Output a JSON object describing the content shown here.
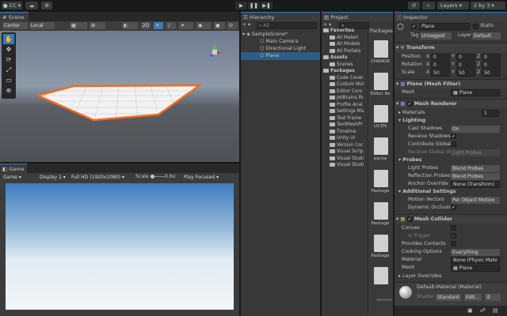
{
  "toolbar": {
    "account": "CC",
    "layers": "Layers",
    "layout": "2 by 3"
  },
  "scene": {
    "tab": "Scene",
    "pivot": "Center",
    "space": "Local",
    "mode2d": "2D",
    "tools": [
      "✋",
      "✥",
      "⟳",
      "⤢",
      "▭",
      "⊕"
    ]
  },
  "game": {
    "tab": "Game",
    "mode": "Game",
    "display": "Display 1",
    "resolution": "Full HD (1920x1080)",
    "scale_label": "Scale",
    "scale_value": "0.6x",
    "play_focused": "Play Focused"
  },
  "hierarchy": {
    "tab": "Hierarchy",
    "search_placeholder": "All",
    "items": [
      "SampleScene*",
      "Main Camera",
      "Directional Light",
      "Plane"
    ]
  },
  "project": {
    "tab": "Project",
    "tree": [
      {
        "label": "Favorites",
        "level": 0
      },
      {
        "label": "All Materi",
        "level": 1
      },
      {
        "label": "All Models",
        "level": 1
      },
      {
        "label": "All Prefabs",
        "level": 1
      },
      {
        "label": "Assets",
        "level": 0
      },
      {
        "label": "Scenes",
        "level": 1
      },
      {
        "label": "Packages",
        "level": 0
      },
      {
        "label": "Code Cover",
        "level": 1
      },
      {
        "label": "Custom NUr",
        "level": 1
      },
      {
        "label": "Editor Coro",
        "level": 1
      },
      {
        "label": "JetBrains Ri",
        "level": 1
      },
      {
        "label": "Profile Anal",
        "level": 1
      },
      {
        "label": "Settings Ma",
        "level": 1
      },
      {
        "label": "Test Frame",
        "level": 1
      },
      {
        "label": "TextMeshPr",
        "level": 1
      },
      {
        "label": "Timeline",
        "level": 1
      },
      {
        "label": "Unity UI",
        "level": 1
      },
      {
        "label": "Version Cor",
        "level": 1
      },
      {
        "label": "Visual Scrip",
        "level": 1
      },
      {
        "label": "Visual Studi",
        "level": 1
      },
      {
        "label": "Visual Studi",
        "level": 1
      }
    ],
    "packages_header": "Packages",
    "files": [
      "CHANGE",
      "Editor Re",
      "LICEN",
      "packa",
      "Package",
      "Package",
      "Package",
      ""
    ]
  },
  "inspector": {
    "tab": "Inspector",
    "object_name": "Plane",
    "static_label": "Static",
    "tag_label": "Tag",
    "tag_value": "Untagged",
    "layer_label": "Layer",
    "layer_value": "Default",
    "transform": {
      "title": "Transform",
      "position": {
        "label": "Position",
        "x": "0",
        "y": "0",
        "z": "0"
      },
      "rotation": {
        "label": "Rotation",
        "x": "0",
        "y": "0",
        "z": "0"
      },
      "scale": {
        "label": "Scale",
        "x": "50",
        "y": "50",
        "z": "50"
      }
    },
    "mesh_filter": {
      "title": "Plane (Mesh Filter)",
      "mesh_label": "Mesh",
      "mesh_value": "Plane"
    },
    "mesh_renderer": {
      "title": "Mesh Renderer",
      "materials_label": "Materials",
      "materials_count": "1",
      "lighting_label": "Lighting",
      "cast_shadows_label": "Cast Shadows",
      "cast_shadows_value": "On",
      "receive_shadows_label": "Receive Shadows",
      "contribute_gi_label": "Contribute Global I",
      "receive_gi_label": "Receive Global Illu",
      "receive_gi_value": "Light Probes",
      "probes_label": "Probes",
      "light_probes_label": "Light Probes",
      "light_probes_value": "Blend Probes",
      "reflection_probes_label": "Reflection Probes",
      "reflection_probes_value": "Blend Probes",
      "anchor_override_label": "Anchor Override",
      "anchor_override_value": "None (Transform)",
      "additional_label": "Additional Settings",
      "motion_vectors_label": "Motion Vectors",
      "motion_vectors_value": "Per Object Motion",
      "dynamic_occlusion_label": "Dynamic Occlusio"
    },
    "mesh_collider": {
      "title": "Mesh Collider",
      "convex_label": "Convex",
      "is_trigger_label": "Is Trigger",
      "provides_contacts_label": "Provides Contacts",
      "cooking_label": "Cooking Options",
      "cooking_value": "Everything",
      "material_label": "Material",
      "material_value": "None (Physic Mate",
      "mesh_label": "Mesh",
      "mesh_value": "Plane",
      "layer_overrides_label": "Layer Overrides"
    },
    "material": {
      "name": "Default-Material (Material)",
      "shader_label": "Shader",
      "shader_value": "Standard",
      "edit": "Edit..."
    },
    "check_mark": "✓"
  },
  "colors": {
    "accent": "#3a79bb",
    "selection": "#2c5d87",
    "plane_outline": "#f26b1d"
  }
}
